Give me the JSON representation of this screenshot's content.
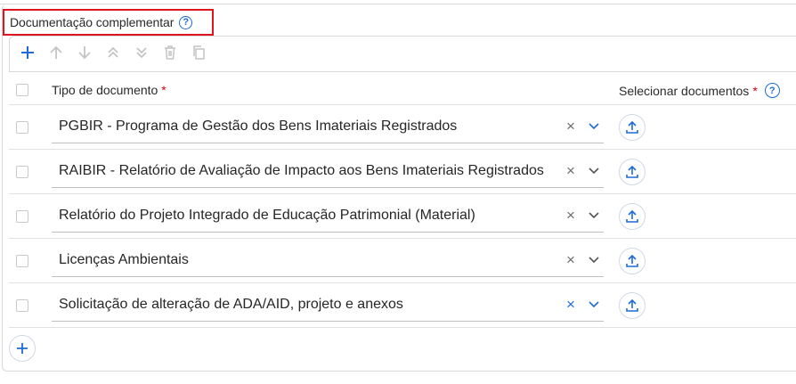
{
  "section": {
    "title": "Documentação complementar",
    "help_icon": "question-circle-icon"
  },
  "toolbar": {
    "buttons": [
      {
        "name": "add-icon",
        "color": "#1e6bd6"
      },
      {
        "name": "arrow-up-icon",
        "color": "#c4c4c4"
      },
      {
        "name": "arrow-down-icon",
        "color": "#c4c4c4"
      },
      {
        "name": "double-chevron-up-icon",
        "color": "#c4c4c4"
      },
      {
        "name": "double-chevron-down-icon",
        "color": "#c4c4c4"
      },
      {
        "name": "trash-icon",
        "color": "#c4c4c4"
      },
      {
        "name": "copy-icon",
        "color": "#c4c4c4"
      }
    ]
  },
  "table": {
    "col_type": "Tipo de documento",
    "col_select": "Selecionar documentos",
    "required_mark": "*",
    "rows": [
      {
        "value": "PGBIR - Programa de Gestão dos Bens Imateriais Registrados"
      },
      {
        "value": "RAIBIR - Relatório de Avaliação de Impacto aos Bens Imateriais Registrados"
      },
      {
        "value": "Relatório do Projeto Integrado de Educação Patrimonial (Material)"
      },
      {
        "value": "Licenças Ambientais"
      },
      {
        "value": "Solicitação de alteração de ADA/AID, projeto e anexos"
      }
    ],
    "clear_symbol": "×"
  },
  "colors": {
    "accent": "#1e6bd6",
    "highlight_border": "#e0141e",
    "required": "#d0021b"
  }
}
